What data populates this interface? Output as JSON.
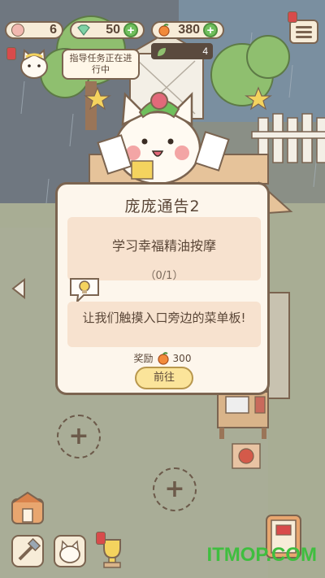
{
  "hud": {
    "paw_count": "6",
    "gem_count": "50",
    "apple_count": "380",
    "leaf_count": "4"
  },
  "guide_bubble": "指导任务正在进行中",
  "modal": {
    "title": "庞庞通告2",
    "task_name": "学习幸福精油按摩",
    "progress": "（0/1）",
    "hint": "让我们触摸入口旁边的菜单板!",
    "reward_label": "奖励",
    "reward_value": "300",
    "go_button": "前往"
  },
  "watermark": "ITMOP.COM",
  "colors": {
    "modal_bg": "#fdf6ec",
    "panel_bg": "#f7e2cf",
    "go_button": "#fbe49a",
    "outline": "#7b6450",
    "watermark": "#3fbe3f"
  }
}
